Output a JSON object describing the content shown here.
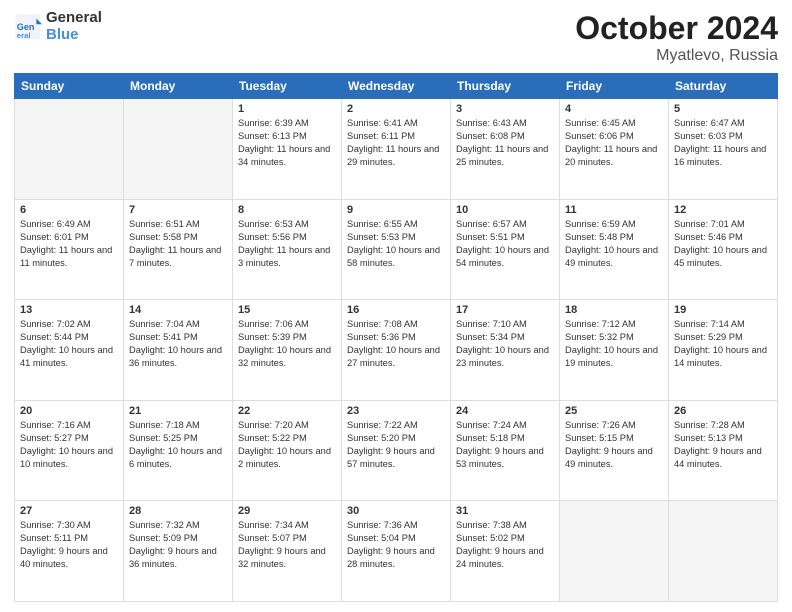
{
  "header": {
    "logo_line1": "General",
    "logo_line2": "Blue",
    "title": "October 2024",
    "subtitle": "Myatlevo, Russia"
  },
  "days_of_week": [
    "Sunday",
    "Monday",
    "Tuesday",
    "Wednesday",
    "Thursday",
    "Friday",
    "Saturday"
  ],
  "weeks": [
    [
      {
        "day": "",
        "empty": true
      },
      {
        "day": "",
        "empty": true
      },
      {
        "day": "1",
        "sunrise": "6:39 AM",
        "sunset": "6:13 PM",
        "daylight": "11 hours and 34 minutes."
      },
      {
        "day": "2",
        "sunrise": "6:41 AM",
        "sunset": "6:11 PM",
        "daylight": "11 hours and 29 minutes."
      },
      {
        "day": "3",
        "sunrise": "6:43 AM",
        "sunset": "6:08 PM",
        "daylight": "11 hours and 25 minutes."
      },
      {
        "day": "4",
        "sunrise": "6:45 AM",
        "sunset": "6:06 PM",
        "daylight": "11 hours and 20 minutes."
      },
      {
        "day": "5",
        "sunrise": "6:47 AM",
        "sunset": "6:03 PM",
        "daylight": "11 hours and 16 minutes."
      }
    ],
    [
      {
        "day": "6",
        "sunrise": "6:49 AM",
        "sunset": "6:01 PM",
        "daylight": "11 hours and 11 minutes."
      },
      {
        "day": "7",
        "sunrise": "6:51 AM",
        "sunset": "5:58 PM",
        "daylight": "11 hours and 7 minutes."
      },
      {
        "day": "8",
        "sunrise": "6:53 AM",
        "sunset": "5:56 PM",
        "daylight": "11 hours and 3 minutes."
      },
      {
        "day": "9",
        "sunrise": "6:55 AM",
        "sunset": "5:53 PM",
        "daylight": "10 hours and 58 minutes."
      },
      {
        "day": "10",
        "sunrise": "6:57 AM",
        "sunset": "5:51 PM",
        "daylight": "10 hours and 54 minutes."
      },
      {
        "day": "11",
        "sunrise": "6:59 AM",
        "sunset": "5:48 PM",
        "daylight": "10 hours and 49 minutes."
      },
      {
        "day": "12",
        "sunrise": "7:01 AM",
        "sunset": "5:46 PM",
        "daylight": "10 hours and 45 minutes."
      }
    ],
    [
      {
        "day": "13",
        "sunrise": "7:02 AM",
        "sunset": "5:44 PM",
        "daylight": "10 hours and 41 minutes."
      },
      {
        "day": "14",
        "sunrise": "7:04 AM",
        "sunset": "5:41 PM",
        "daylight": "10 hours and 36 minutes."
      },
      {
        "day": "15",
        "sunrise": "7:06 AM",
        "sunset": "5:39 PM",
        "daylight": "10 hours and 32 minutes."
      },
      {
        "day": "16",
        "sunrise": "7:08 AM",
        "sunset": "5:36 PM",
        "daylight": "10 hours and 27 minutes."
      },
      {
        "day": "17",
        "sunrise": "7:10 AM",
        "sunset": "5:34 PM",
        "daylight": "10 hours and 23 minutes."
      },
      {
        "day": "18",
        "sunrise": "7:12 AM",
        "sunset": "5:32 PM",
        "daylight": "10 hours and 19 minutes."
      },
      {
        "day": "19",
        "sunrise": "7:14 AM",
        "sunset": "5:29 PM",
        "daylight": "10 hours and 14 minutes."
      }
    ],
    [
      {
        "day": "20",
        "sunrise": "7:16 AM",
        "sunset": "5:27 PM",
        "daylight": "10 hours and 10 minutes."
      },
      {
        "day": "21",
        "sunrise": "7:18 AM",
        "sunset": "5:25 PM",
        "daylight": "10 hours and 6 minutes."
      },
      {
        "day": "22",
        "sunrise": "7:20 AM",
        "sunset": "5:22 PM",
        "daylight": "10 hours and 2 minutes."
      },
      {
        "day": "23",
        "sunrise": "7:22 AM",
        "sunset": "5:20 PM",
        "daylight": "9 hours and 57 minutes."
      },
      {
        "day": "24",
        "sunrise": "7:24 AM",
        "sunset": "5:18 PM",
        "daylight": "9 hours and 53 minutes."
      },
      {
        "day": "25",
        "sunrise": "7:26 AM",
        "sunset": "5:15 PM",
        "daylight": "9 hours and 49 minutes."
      },
      {
        "day": "26",
        "sunrise": "7:28 AM",
        "sunset": "5:13 PM",
        "daylight": "9 hours and 44 minutes."
      }
    ],
    [
      {
        "day": "27",
        "sunrise": "7:30 AM",
        "sunset": "5:11 PM",
        "daylight": "9 hours and 40 minutes."
      },
      {
        "day": "28",
        "sunrise": "7:32 AM",
        "sunset": "5:09 PM",
        "daylight": "9 hours and 36 minutes."
      },
      {
        "day": "29",
        "sunrise": "7:34 AM",
        "sunset": "5:07 PM",
        "daylight": "9 hours and 32 minutes."
      },
      {
        "day": "30",
        "sunrise": "7:36 AM",
        "sunset": "5:04 PM",
        "daylight": "9 hours and 28 minutes."
      },
      {
        "day": "31",
        "sunrise": "7:38 AM",
        "sunset": "5:02 PM",
        "daylight": "9 hours and 24 minutes."
      },
      {
        "day": "",
        "empty": true
      },
      {
        "day": "",
        "empty": true
      }
    ]
  ]
}
